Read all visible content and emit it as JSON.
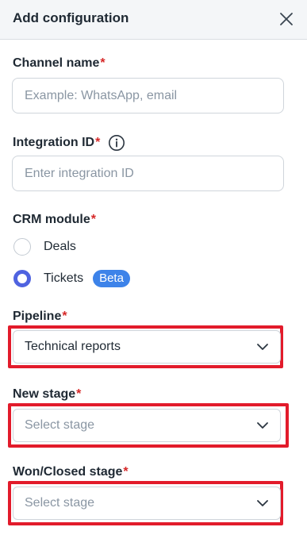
{
  "header": {
    "title": "Add configuration",
    "close_icon": "close-icon"
  },
  "form": {
    "required_mark": "*",
    "channel_name": {
      "label": "Channel name",
      "placeholder": "Example: WhatsApp, email",
      "value": ""
    },
    "integration_id": {
      "label": "Integration ID",
      "placeholder": "Enter integration ID",
      "value": "",
      "info_icon": "info-icon"
    },
    "crm_module": {
      "label": "CRM module",
      "options": [
        {
          "label": "Deals",
          "selected": false
        },
        {
          "label": "Tickets",
          "selected": true,
          "badge": "Beta"
        }
      ]
    },
    "pipeline": {
      "label": "Pipeline",
      "value": "Technical reports"
    },
    "new_stage": {
      "label": "New stage",
      "placeholder": "Select stage"
    },
    "won_closed_stage": {
      "label": "Won/Closed stage",
      "placeholder": "Select stage"
    }
  },
  "colors": {
    "required": "#d62828",
    "radio_selected": "#4f63e0",
    "badge_bg": "#3d83e9",
    "highlight": "#e21b2b",
    "header_bg": "#f4f6f8"
  }
}
